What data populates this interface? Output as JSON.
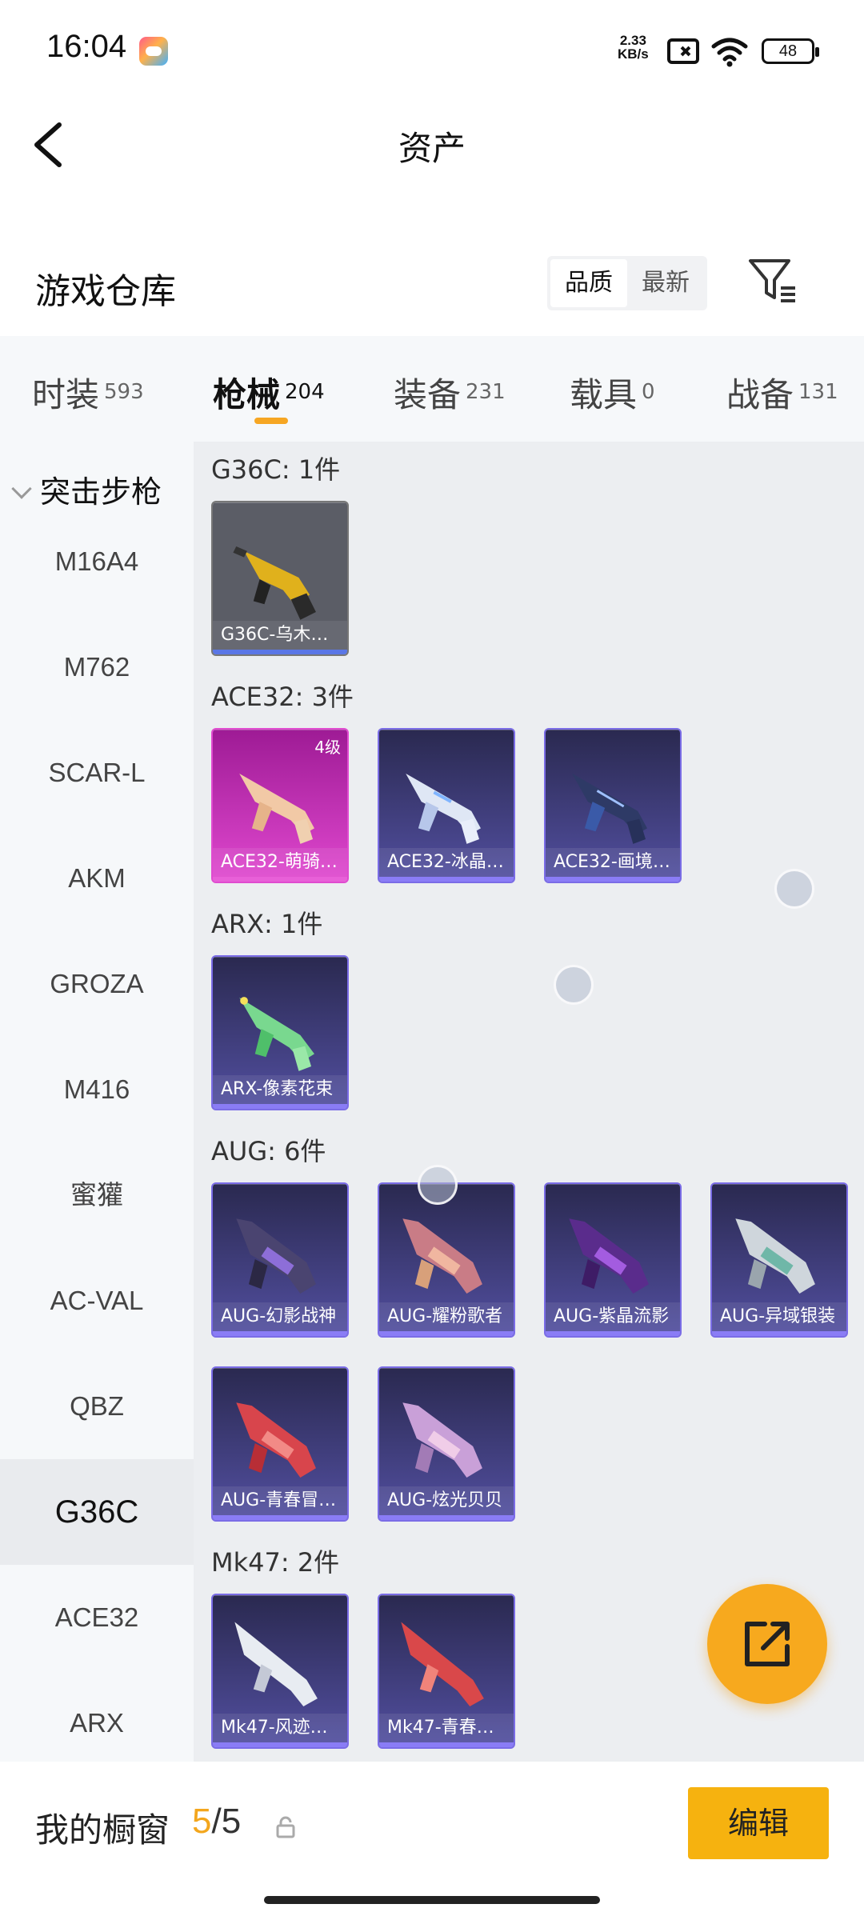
{
  "status": {
    "time": "16:04",
    "net_speed_value": "2.33",
    "net_speed_unit": "KB/s",
    "battery": "48"
  },
  "header": {
    "title": "资产"
  },
  "warehouse": {
    "title": "游戏仓库",
    "sort_quality": "品质",
    "sort_latest": "最新"
  },
  "categories": [
    {
      "label": "时装",
      "count": "593"
    },
    {
      "label": "枪械",
      "count": "204"
    },
    {
      "label": "装备",
      "count": "231"
    },
    {
      "label": "载具",
      "count": "0"
    },
    {
      "label": "战备",
      "count": "131"
    }
  ],
  "sidebar": {
    "group": "突击步枪",
    "items": [
      "M16A4",
      "M762",
      "SCAR-L",
      "AKM",
      "GROZA",
      "M416",
      "蜜獾",
      "AC-VAL",
      "QBZ",
      "G36C",
      "ACE32",
      "ARX"
    ],
    "active_index": 9
  },
  "groups": [
    {
      "label": "G36C: 1件",
      "items": [
        {
          "name": "G36C-乌木…",
          "style": "grey"
        }
      ]
    },
    {
      "label": "ACE32: 3件",
      "items": [
        {
          "name": "ACE32-萌骑…",
          "style": "pink",
          "level": "4级"
        },
        {
          "name": "ACE32-冰晶…",
          "style": "purple"
        },
        {
          "name": "ACE32-画境…",
          "style": "purple"
        }
      ]
    },
    {
      "label": "ARX: 1件",
      "items": [
        {
          "name": "ARX-像素花束",
          "style": "purple"
        }
      ]
    },
    {
      "label": "AUG: 6件",
      "items": [
        {
          "name": "AUG-幻影战神",
          "style": "purple"
        },
        {
          "name": "AUG-耀粉歌者",
          "style": "purple"
        },
        {
          "name": "AUG-紫晶流影",
          "style": "purple"
        },
        {
          "name": "AUG-异域银装",
          "style": "purple"
        },
        {
          "name": "AUG-青春冒…",
          "style": "purple"
        },
        {
          "name": "AUG-炫光贝贝",
          "style": "purple"
        }
      ]
    },
    {
      "label": "Mk47: 2件",
      "items": [
        {
          "name": "Mk47-风迹…",
          "style": "purple"
        },
        {
          "name": "Mk47-青春…",
          "style": "purple"
        }
      ]
    }
  ],
  "bottom": {
    "label": "我的橱窗",
    "current": "5",
    "separator": "/",
    "max": "5",
    "edit": "编辑"
  },
  "colors": {
    "accent": "#f6b20f",
    "purple_card": "#3b3a6e",
    "pink_card": "#b22aa6"
  }
}
